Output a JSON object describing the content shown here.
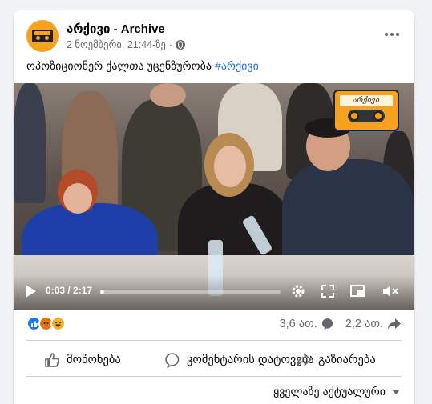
{
  "post": {
    "page_name": "არქივი - Archive",
    "date": "2 ნოემბერი, 21:44-ზე",
    "separator": "·",
    "text": "ოპოზიციონერ ქალთა უცენზურობა ",
    "hashtag": "#არქივი"
  },
  "video": {
    "logo_label": "არქივი",
    "current_time": "0:03",
    "time_separator": " / ",
    "duration": "2:17",
    "progress_fraction": 0.02
  },
  "stats": {
    "comments": "3,6 ათ.",
    "shares": "2,2 ათ."
  },
  "actions": {
    "like": "მოწონება",
    "comment": "კომენტარის დატოვება",
    "share": "გაზიარება"
  },
  "sort": {
    "label": "ყველაზე აქტუალური"
  },
  "colors": {
    "accent": "#1877f2",
    "hashtag": "#216fdb",
    "brand_orange": "#f7a21e"
  }
}
